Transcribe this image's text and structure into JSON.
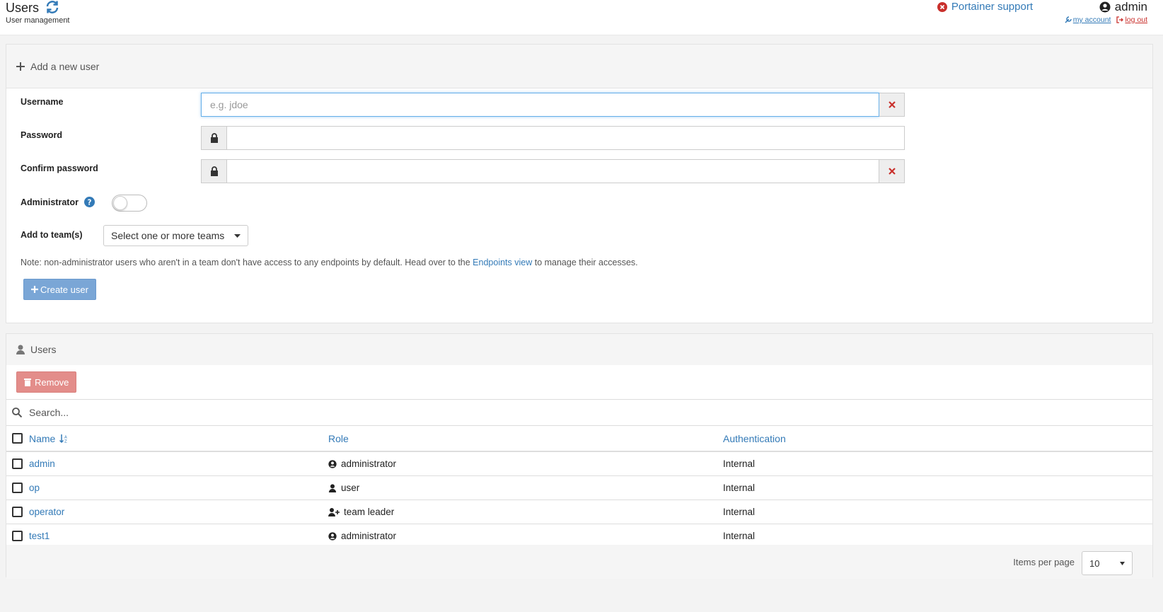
{
  "header": {
    "title": "Users",
    "subtitle": "User management",
    "support_label": "Portainer support",
    "username": "admin",
    "my_account_label": "my account",
    "logout_label": "log out"
  },
  "add_user": {
    "title": "Add a new user",
    "username_label": "Username",
    "username_placeholder": "e.g. jdoe",
    "username_value": "",
    "password_label": "Password",
    "password_value": "",
    "confirm_label": "Confirm password",
    "confirm_value": "",
    "admin_label": "Administrator",
    "admin_enabled": false,
    "teams_label": "Add to team(s)",
    "teams_select": "Select one or more teams",
    "note_before": "Note: non-administrator users who aren't in a team don't have access to any endpoints by default. Head over to the ",
    "note_link": "Endpoints view",
    "note_after": " to manage their accesses.",
    "create_label": "Create user"
  },
  "users_table": {
    "title": "Users",
    "remove_label": "Remove",
    "search_placeholder": "Search...",
    "columns": {
      "name": "Name",
      "role": "Role",
      "auth": "Authentication"
    },
    "rows": [
      {
        "name": "admin",
        "role": "administrator",
        "role_icon": "user-circle-icon",
        "auth": "Internal"
      },
      {
        "name": "op",
        "role": "user",
        "role_icon": "user-icon",
        "auth": "Internal"
      },
      {
        "name": "operator",
        "role": "team leader",
        "role_icon": "user-plus-icon",
        "auth": "Internal"
      },
      {
        "name": "test1",
        "role": "administrator",
        "role_icon": "user-circle-icon",
        "auth": "Internal"
      }
    ],
    "items_per_page_label": "Items per page",
    "items_per_page_value": "10"
  },
  "colors": {
    "link": "#337ab7",
    "danger": "#c9302c",
    "create": "#7aa6d6",
    "remove": "#e38d8a"
  }
}
